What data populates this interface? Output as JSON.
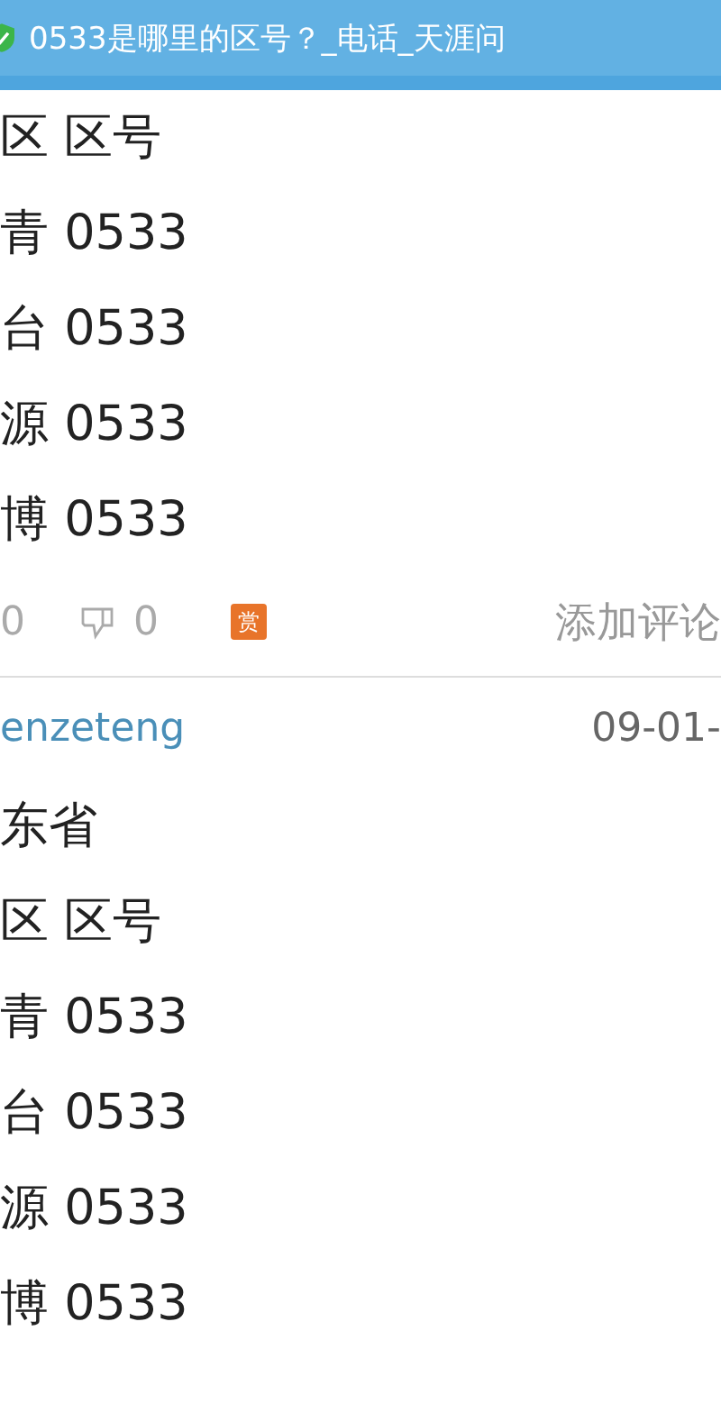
{
  "title_bar": {
    "title": "0533是哪里的区号？_电话_天涯问"
  },
  "answers": [
    {
      "lines": [
        "区 区号",
        "青 0533",
        "台 0533",
        "源 0533",
        "博 0533"
      ],
      "actions": {
        "likes": "0",
        "dislikes": "0",
        "reward": "赏",
        "comment": "添加评论"
      }
    },
    {
      "author": "enzeteng",
      "date": "09-01-",
      "lines": [
        "东省",
        "区 区号",
        "青 0533",
        "台 0533",
        "源 0533",
        "博 0533"
      ]
    }
  ]
}
